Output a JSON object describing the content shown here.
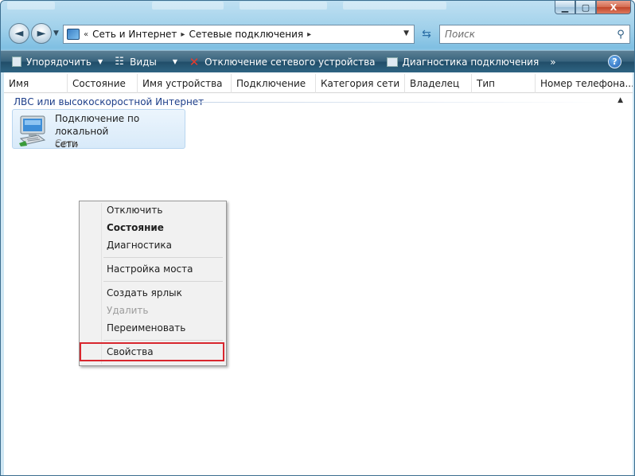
{
  "window": {
    "min_icon": "minimize-icon",
    "max_icon": "maximize-icon",
    "close_icon": "close-icon",
    "close_glyph": "X"
  },
  "nav": {
    "back_glyph": "◄",
    "forward_glyph": "►"
  },
  "address": {
    "prefix": "«",
    "crumbs": [
      "Сеть и Интернет",
      "Сетевые подключения"
    ],
    "sep": "▸"
  },
  "search": {
    "placeholder": "Поиск"
  },
  "toolbar": {
    "organize": "Упорядочить",
    "views": "Виды",
    "disable_device": "Отключение сетевого устройства",
    "diagnose": "Диагностика подключения",
    "more": "»",
    "help": "?"
  },
  "columns": [
    "Имя",
    "Состояние",
    "Имя устройства",
    "Подключение",
    "Категория сети",
    "Владелец",
    "Тип",
    "Номер телефона..."
  ],
  "group": {
    "title": "ЛВС или высокоскоростной Интернет"
  },
  "connection": {
    "name_line1": "Подключение по локальной",
    "name_line2": "сети",
    "status": "Сеть"
  },
  "context_menu": {
    "items": [
      {
        "label": "Отключить",
        "style": "normal"
      },
      {
        "label": "Состояние",
        "style": "bold"
      },
      {
        "label": "Диагностика",
        "style": "normal"
      },
      {
        "label": "Настройка моста",
        "style": "normal"
      },
      {
        "label": "Создать ярлык",
        "style": "normal"
      },
      {
        "label": "Удалить",
        "style": "disabled"
      },
      {
        "label": "Переименовать",
        "style": "normal"
      },
      {
        "label": "Свойства",
        "style": "normal"
      }
    ],
    "highlight_color": "#d8262e"
  },
  "colors": {
    "toolbar": "#2e6483",
    "group_text": "#1e3f8a",
    "selection": "#d8eaf9"
  }
}
